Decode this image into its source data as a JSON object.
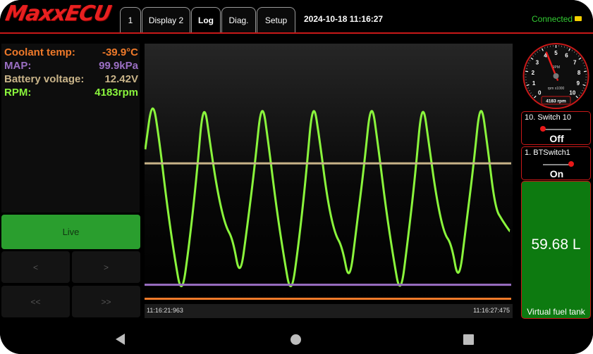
{
  "header": {
    "logo": "MaxxECU",
    "tabs": [
      {
        "label": "1"
      },
      {
        "label": "Display 2"
      },
      {
        "label": "Log",
        "active": true
      },
      {
        "label": "Diag."
      },
      {
        "label": "Setup"
      }
    ],
    "datetime": "2024-10-18 11:16:27",
    "status": "Connected"
  },
  "values": [
    {
      "label": "Coolant temp:",
      "value": "-39.9°C",
      "color": "#f07a2a"
    },
    {
      "label": "MAP:",
      "value": "99.9kPa",
      "color": "#9b6fc4"
    },
    {
      "label": "Battery voltage:",
      "value": "12.42V",
      "color": "#c9b489"
    },
    {
      "label": "RPM:",
      "value": "4183rpm",
      "color": "#8af53c"
    }
  ],
  "controls": {
    "live_label": "Live",
    "prev_label": "<",
    "next_label": ">",
    "rewind_label": "<<",
    "forward_label": ">>"
  },
  "chart_data": {
    "type": "line",
    "x_start_label": "11:16:21:963",
    "x_end_label": "11:16:27:475",
    "x_range_s": [
      0,
      5.512
    ],
    "series": [
      {
        "name": "RPM",
        "color": "#8af53c",
        "normalized": true,
        "values": [
          0.6,
          0.81,
          0.62,
          0.38,
          0.18,
          0.02,
          0.22,
          0.48,
          0.81,
          0.6,
          0.42,
          0.3,
          0.25,
          0.09,
          0.3,
          0.53,
          0.81,
          0.6,
          0.37,
          0.18,
          0.02,
          0.22,
          0.48,
          0.81,
          0.62,
          0.4,
          0.27,
          0.22,
          0.07,
          0.3,
          0.53,
          0.81,
          0.6,
          0.37,
          0.18,
          0.02,
          0.24,
          0.49,
          0.81,
          0.6,
          0.4,
          0.27,
          0.23,
          0.07,
          0.3,
          0.53,
          0.81,
          0.6,
          0.37,
          0.32,
          0.28
        ]
      },
      {
        "name": "Battery voltage",
        "color": "#c9b489",
        "normalized": true,
        "values": [
          0.545
        ]
      },
      {
        "name": "MAP",
        "color": "#9b6fc4",
        "normalized": true,
        "values": [
          0.07
        ]
      },
      {
        "name": "Coolant temp",
        "color": "#f07a2a",
        "normalized": true,
        "values": [
          0.015
        ]
      }
    ]
  },
  "gauge": {
    "unit_label": "RPM",
    "scale_label": "rpm x1000",
    "ticks": [
      "0",
      "1",
      "2",
      "3",
      "4",
      "5",
      "6",
      "7",
      "8",
      "9",
      "10"
    ],
    "max": 10,
    "value": 4.183,
    "readout": "4183 rpm"
  },
  "switches": [
    {
      "title": "10. Switch 10",
      "state": "Off"
    },
    {
      "title": "1. BTSwitch1",
      "state": "On"
    }
  ],
  "fuel": {
    "value": "59.68 L",
    "label": "Virtual fuel tank"
  }
}
